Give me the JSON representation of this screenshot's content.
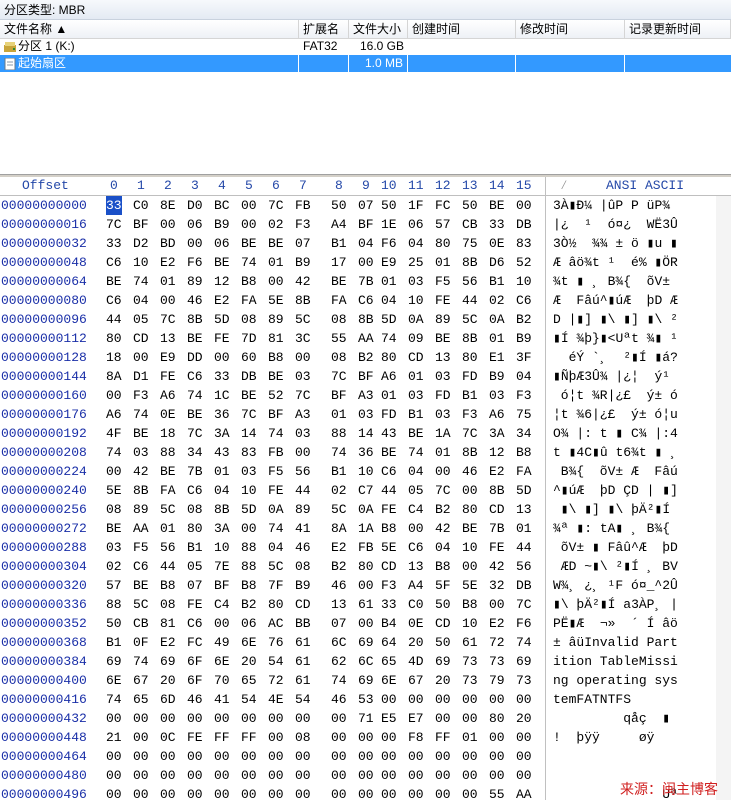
{
  "partition_type": "分区类型: MBR",
  "file_list": {
    "columns": [
      "文件名称",
      "扩展名",
      "文件大小",
      "创建时间",
      "修改时间",
      "记录更新时间"
    ],
    "rows": [
      {
        "name": "分区 1 (K:)",
        "ext": "FAT32",
        "size": "16.0 GB",
        "icon": "drive-icon"
      },
      {
        "name": "起始扇区",
        "ext": "",
        "size": "1.0 MB",
        "icon": "sector-file-icon",
        "selected": true
      }
    ]
  },
  "hex_header": {
    "offset_label": "Offset",
    "columns": [
      "0",
      "1",
      "2",
      "3",
      "4",
      "5",
      "6",
      "7",
      "8",
      "9",
      "10",
      "11",
      "12",
      "13",
      "14",
      "15"
    ],
    "ascii_label": "ANSI ASCII"
  },
  "hex_rows": [
    {
      "offset": "00000000000",
      "bytes": "33 C0 8E D0 BC 00 7C FB 50 07 50 1F FC 50 BE 00",
      "ascii": "3À▮Ð¼ |ûP P üP¾"
    },
    {
      "offset": "00000000016",
      "bytes": "7C BF 00 06 B9 00 02 F3 A4 BF 1E 06 57 CB 33 DB",
      "ascii": "|¿  ¹  ó¤¿  WË3Û"
    },
    {
      "offset": "00000000032",
      "bytes": "33 D2 BD 00 06 BE BE 07 B1 04 F6 04 80 75 0E 83",
      "ascii": "3Ò½  ¾¾ ± ö ▮u ▮"
    },
    {
      "offset": "00000000048",
      "bytes": "C6 10 E2 F6 BE 74 01 B9 17 00 E9 25 01 8B D6 52",
      "ascii": "Æ âö¾t ¹  é% ▮ÖR"
    },
    {
      "offset": "00000000064",
      "bytes": "BE 74 01 89 12 B8 00 42 BE 7B 01 03 F5 56 B1 10",
      "ascii": "¾t ▮ ¸ B¾{  õV± "
    },
    {
      "offset": "00000000080",
      "bytes": "C6 04 00 46 E2 FA 5E 8B FA C6 04 10 FE 44 02 C6",
      "ascii": "Æ  Fâú^▮úÆ  þD Æ"
    },
    {
      "offset": "00000000096",
      "bytes": "44 05 7C 8B 5D 08 89 5C 08 8B 5D 0A 89 5C 0A B2",
      "ascii": "D |▮] ▮\\ ▮] ▮\\ ²"
    },
    {
      "offset": "00000000112",
      "bytes": "80 CD 13 BE FE 7D 81 3C 55 AA 74 09 BE 8B 01 B9",
      "ascii": "▮Í ¾þ}▮<Uªt ¾▮ ¹"
    },
    {
      "offset": "00000000128",
      "bytes": "18 00 E9 DD 00 60 B8 00 08 B2 80 CD 13 80 E1 3F",
      "ascii": "  éÝ `¸  ²▮Í ▮á?"
    },
    {
      "offset": "00000000144",
      "bytes": "8A D1 FE C6 33 DB BE 03 7C BF A6 01 03 FD B9 04",
      "ascii": "▮ÑþÆ3Û¾ |¿¦  ý¹ "
    },
    {
      "offset": "00000000160",
      "bytes": "00 F3 A6 74 1C BE 52 7C BF A3 01 03 FD B1 03 F3",
      "ascii": " ó¦t ¾R|¿£  ý± ó"
    },
    {
      "offset": "00000000176",
      "bytes": "A6 74 0E BE 36 7C BF A3 01 03 FD B1 03 F3 A6 75",
      "ascii": "¦t ¾6|¿£  ý± ó¦u"
    },
    {
      "offset": "00000000192",
      "bytes": "4F BE 18 7C 3A 14 74 03 88 14 43 BE 1A 7C 3A 34",
      "ascii": "O¾ |: t ▮ C¾ |:4"
    },
    {
      "offset": "00000000208",
      "bytes": "74 03 88 34 43 83 FB 00 74 36 BE 74 01 8B 12 B8",
      "ascii": "t ▮4C▮û t6¾t ▮ ¸"
    },
    {
      "offset": "00000000224",
      "bytes": "00 42 BE 7B 01 03 F5 56 B1 10 C6 04 00 46 E2 FA",
      "ascii": " B¾{  õV± Æ  Fâú"
    },
    {
      "offset": "00000000240",
      "bytes": "5E 8B FA C6 04 10 FE 44 02 C7 44 05 7C 00 8B 5D",
      "ascii": "^▮úÆ  þD ÇD | ▮]"
    },
    {
      "offset": "00000000256",
      "bytes": "08 89 5C 08 8B 5D 0A 89 5C 0A FE C4 B2 80 CD 13",
      "ascii": " ▮\\ ▮] ▮\\ þÄ²▮Í "
    },
    {
      "offset": "00000000272",
      "bytes": "BE AA 01 80 3A 00 74 41 8A 1A B8 00 42 BE 7B 01",
      "ascii": "¾ª ▮: tA▮ ¸ B¾{ "
    },
    {
      "offset": "00000000288",
      "bytes": "03 F5 56 B1 10 88 04 46 E2 FB 5E C6 04 10 FE 44",
      "ascii": " õV± ▮ Fâû^Æ  þD"
    },
    {
      "offset": "00000000304",
      "bytes": "02 C6 44 05 7E 88 5C 08 B2 80 CD 13 B8 00 42 56",
      "ascii": " ÆD ~▮\\ ²▮Í ¸ BV"
    },
    {
      "offset": "00000000320",
      "bytes": "57 BE B8 07 BF B8 7F B9 46 00 F3 A4 5F 5E 32 DB",
      "ascii": "W¾¸ ¿¸ ¹F ó¤_^2Û"
    },
    {
      "offset": "00000000336",
      "bytes": "88 5C 08 FE C4 B2 80 CD 13 61 33 C0 50 B8 00 7C",
      "ascii": "▮\\ þÄ²▮Í a3ÀP¸ |"
    },
    {
      "offset": "00000000352",
      "bytes": "50 CB 81 C6 00 06 AC BB 07 00 B4 0E CD 10 E2 F6",
      "ascii": "PË▮Æ  ¬»  ´ Í âö"
    },
    {
      "offset": "00000000368",
      "bytes": "B1 0F E2 FC 49 6E 76 61 6C 69 64 20 50 61 72 74",
      "ascii": "± âüInvalid Part"
    },
    {
      "offset": "00000000384",
      "bytes": "69 74 69 6F 6E 20 54 61 62 6C 65 4D 69 73 73 69",
      "ascii": "ition TableMissi"
    },
    {
      "offset": "00000000400",
      "bytes": "6E 67 20 6F 70 65 72 61 74 69 6E 67 20 73 79 73",
      "ascii": "ng operating sys"
    },
    {
      "offset": "00000000416",
      "bytes": "74 65 6D 46 41 54 4E 54 46 53 00 00 00 00 00 00",
      "ascii": "temFATNTFS      "
    },
    {
      "offset": "00000000432",
      "bytes": "00 00 00 00 00 00 00 00 00 71 E5 E7 00 00 80 20",
      "ascii": "         qåç  ▮ "
    },
    {
      "offset": "00000000448",
      "bytes": "21 00 0C FE FF FF 00 08 00 00 00 F8 FF 01 00 00",
      "ascii": "!  þÿÿ     øÿ   "
    },
    {
      "offset": "00000000464",
      "bytes": "00 00 00 00 00 00 00 00 00 00 00 00 00 00 00 00",
      "ascii": "                "
    },
    {
      "offset": "00000000480",
      "bytes": "00 00 00 00 00 00 00 00 00 00 00 00 00 00 00 00",
      "ascii": "                "
    },
    {
      "offset": "00000000496",
      "bytes": "00 00 00 00 00 00 00 00 00 00 00 00 00 00 55 AA",
      "ascii": "              Uª"
    }
  ],
  "watermark": "来源：闽主博客"
}
